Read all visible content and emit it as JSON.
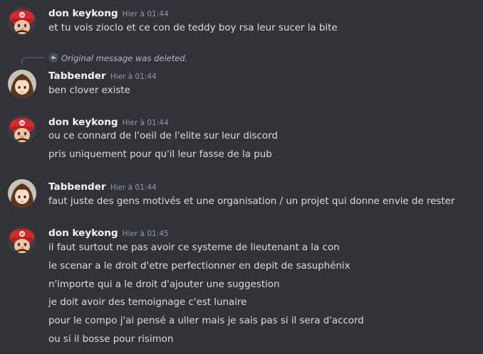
{
  "reply": {
    "deleted_text": "Original message was deleted."
  },
  "messages": [
    {
      "author": "don keykong",
      "time": "Hier à 01:44",
      "lines": [
        "et tu vois zioclo et ce con de teddy boy rsa leur sucer la bite"
      ]
    },
    {
      "author": "Tabbender",
      "time": "Hier à 01:44",
      "lines": [
        "ben clover existe"
      ]
    },
    {
      "author": "don keykong",
      "time": "Hier à 01:44",
      "lines": [
        "ou ce connard de l'oeil de l'elite sur leur discord",
        "pris uniquement pour qu'il leur fasse de la pub"
      ]
    },
    {
      "author": "Tabbender",
      "time": "Hier à 01:44",
      "lines": [
        "faut juste des gens motivés et une organisation / un projet qui donne envie de rester"
      ]
    },
    {
      "author": "don keykong",
      "time": "Hier à 01:45",
      "lines": [
        "il faut surtout ne pas avoir ce systeme de lieutenant a la con",
        "le scenar a le droit d'etre perfectionner en depit de sasuphénix",
        "n'importe qui a le droit d'ajouter une suggestion",
        "je doit avoir des temoignage c'est lunaire",
        "pour le compo j'ai pensé a uller mais je sais pas si il sera d'accord",
        "ou si il bosse pour risimon"
      ]
    }
  ],
  "icons": {
    "reply": "reply-arrow-icon",
    "avatar_don": "mario-avatar-icon",
    "avatar_tab": "brown-hair-avatar-icon"
  },
  "colors": {
    "background": "#313338",
    "username": "#f2f3f5",
    "text": "#dbdee1",
    "timestamp": "#949ba4",
    "mario_red": "#d8282a"
  }
}
